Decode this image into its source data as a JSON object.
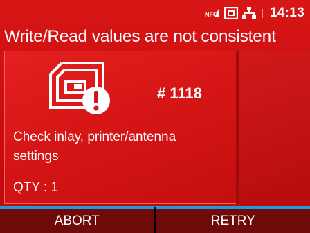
{
  "status_bar": {
    "time": "14:13",
    "icons": [
      "nfc-icon",
      "storage-card-icon",
      "network-icon",
      "signal-icon"
    ]
  },
  "title": "Write/Read values are not consistent",
  "error": {
    "icon": "rfid-tag-warning-icon",
    "code": "# 1118",
    "message": "Check inlay, printer/antenna settings",
    "qty": "QTY : 1"
  },
  "buttons": {
    "abort_label": "ABORT",
    "retry_label": "RETRY"
  },
  "colors": {
    "background": "#c80d0d",
    "button_bg": "#6f0a0a",
    "button_accent": "#1f9bd9",
    "text": "#ffffff"
  }
}
